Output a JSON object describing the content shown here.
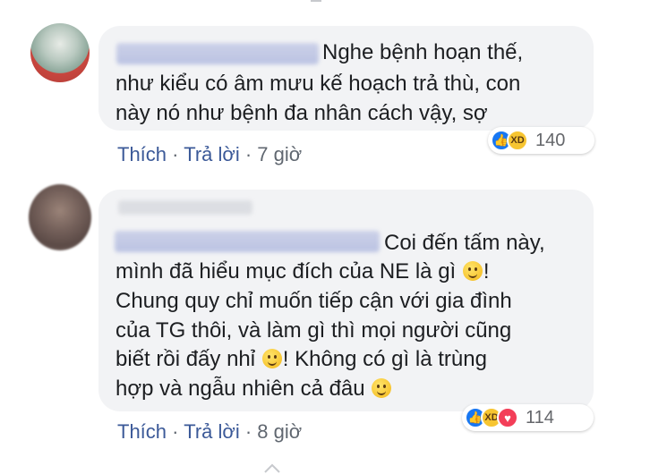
{
  "comments": [
    {
      "body_lines": [
        "Nghe bệnh hoạn thế,",
        "như kiểu có âm mưu kế hoạch trả thù, con",
        "này nó như bệnh đa nhân cách vậy, sợ"
      ],
      "reactions": [
        "like-icon",
        "haha-icon"
      ],
      "reaction_count": "140",
      "actions": {
        "like": "Thích",
        "reply": "Trả lời",
        "separator": "·",
        "time": "7 giờ"
      }
    },
    {
      "body_lines": [
        "Coi đến tấm này,",
        "mình đã hiểu mục đích của NE là gì",
        "Chung quy chỉ muốn tiếp cận với gia đình",
        "của TG thôi, và làm gì thì mọi người cũng",
        "biết rồi đấy nhỉ",
        "! Không có gì là trùng",
        "hợp và ngẫu nhiên cả đâu"
      ],
      "reactions": [
        "like-icon",
        "haha-icon",
        "love-icon"
      ],
      "reaction_count": "114",
      "actions": {
        "like": "Thích",
        "reply": "Trả lời",
        "separator": "·",
        "time": "8 giờ"
      }
    }
  ],
  "colors": {
    "bubble": "#f2f3f5",
    "link": "#3b5998",
    "meta": "#606770",
    "like": "#1877f2",
    "haha": "#f7c531",
    "love": "#f33e58"
  }
}
